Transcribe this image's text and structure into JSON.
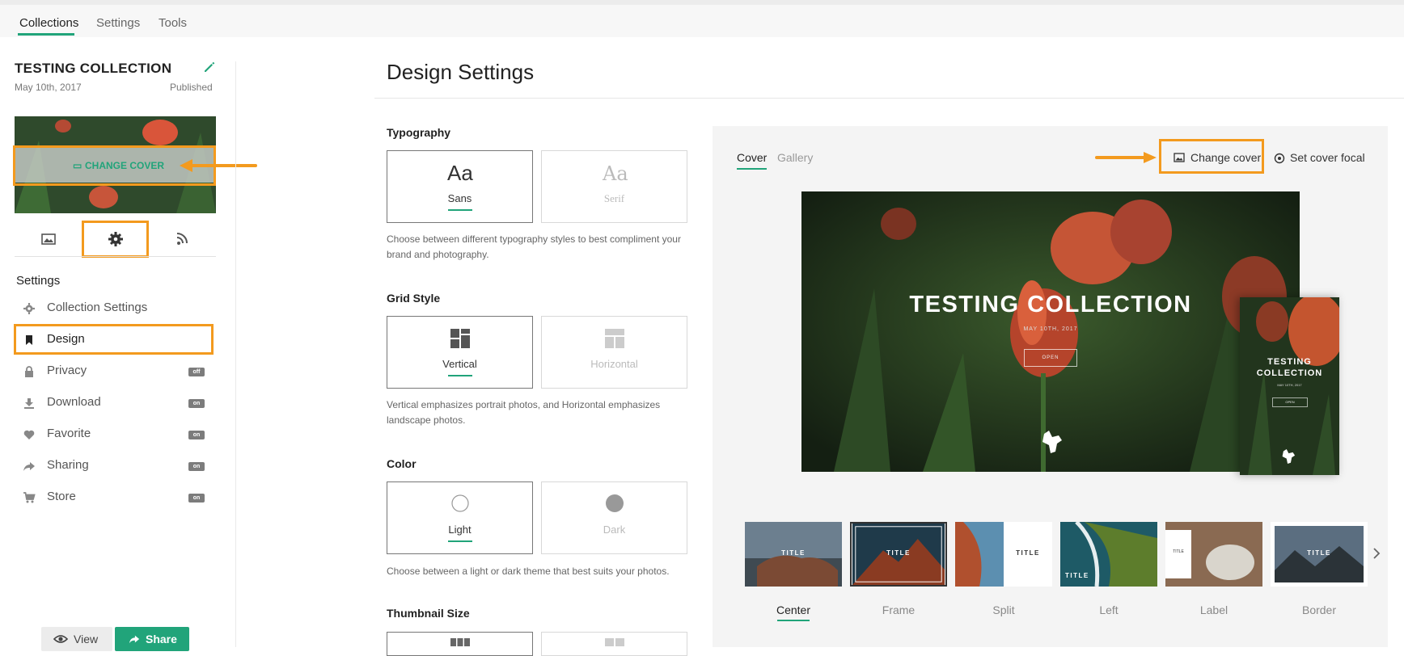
{
  "topnav": {
    "tabs": [
      "Collections",
      "Settings",
      "Tools"
    ]
  },
  "collection": {
    "title": "TESTING COLLECTION",
    "date": "May 10th, 2017",
    "status": "Published",
    "change_cover_label": "CHANGE COVER"
  },
  "sidebar": {
    "section_title": "Settings",
    "items": [
      {
        "label": "Collection Settings",
        "icon": "gear-icon"
      },
      {
        "label": "Design",
        "icon": "bookmark-icon"
      },
      {
        "label": "Privacy",
        "icon": "lock-icon",
        "badge": "off"
      },
      {
        "label": "Download",
        "icon": "download-icon",
        "badge": "on"
      },
      {
        "label": "Favorite",
        "icon": "heart-icon",
        "badge": "on"
      },
      {
        "label": "Sharing",
        "icon": "share-arrow-icon",
        "badge": "on"
      },
      {
        "label": "Store",
        "icon": "cart-icon",
        "badge": "on"
      }
    ],
    "view_label": "View",
    "share_label": "Share"
  },
  "design": {
    "page_title": "Design Settings",
    "typography": {
      "title": "Typography",
      "options": [
        "Sans",
        "Serif"
      ],
      "glyph": "Aa",
      "description": "Choose between different typography styles to best compliment your brand and photography."
    },
    "grid_style": {
      "title": "Grid Style",
      "options": [
        "Vertical",
        "Horizontal"
      ],
      "description": "Vertical emphasizes portrait photos, and Horizontal emphasizes landscape photos."
    },
    "color": {
      "title": "Color",
      "options": [
        "Light",
        "Dark"
      ],
      "description": "Choose between a light or dark theme that best suits your photos."
    },
    "thumbnail_size": {
      "title": "Thumbnail Size"
    }
  },
  "preview": {
    "tabs": [
      "Cover",
      "Gallery"
    ],
    "change_cover_label": "Change cover",
    "set_focal_label": "Set cover focal",
    "hero": {
      "title": "TESTING COLLECTION",
      "date": "MAY 10TH, 2017",
      "button": "OPEN"
    },
    "mobile": {
      "title_line1": "TESTING",
      "title_line2": "COLLECTION",
      "date": "MAY 10TH, 2017",
      "button": "OPEN"
    },
    "thumbnail_label": "TITLE",
    "layouts": [
      "Center",
      "Frame",
      "Split",
      "Left",
      "Label",
      "Border"
    ]
  },
  "colors": {
    "accent": "#21a47a",
    "highlight": "#f39a1e"
  }
}
